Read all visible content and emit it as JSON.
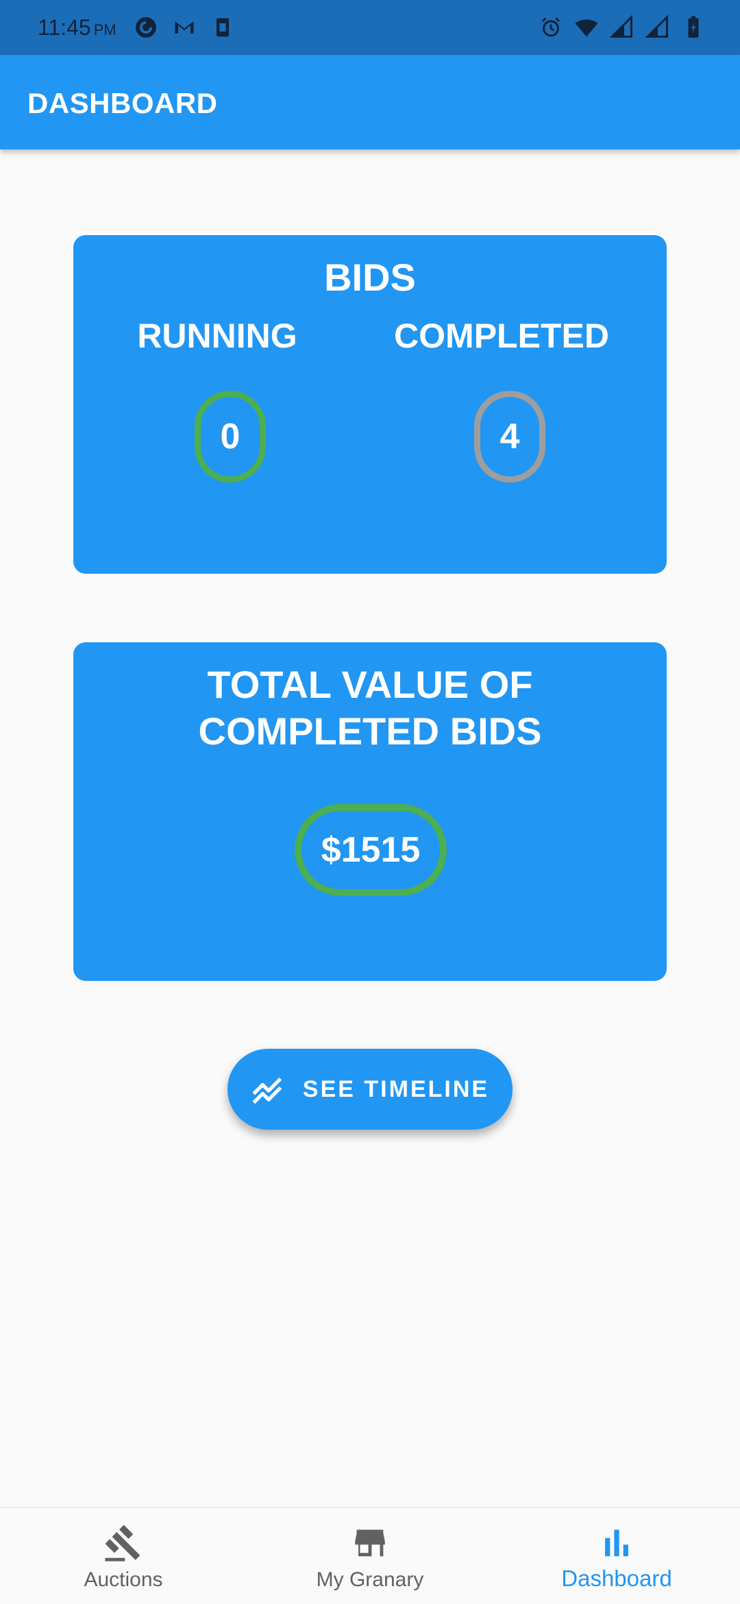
{
  "status_bar": {
    "time": "11:45",
    "ampm": "PM",
    "left_icons": [
      "pocket-casts-icon",
      "gmail-icon",
      "sim-card-icon"
    ],
    "right_icons": [
      "alarm-icon",
      "wifi-icon",
      "signal-icon",
      "signal-icon",
      "battery-icon"
    ]
  },
  "app_bar": {
    "title": "DASHBOARD"
  },
  "bids_card": {
    "title": "BIDS",
    "running_label": "RUNNING",
    "running_count": "0",
    "completed_label": "COMPLETED",
    "completed_count": "4"
  },
  "total_card": {
    "title": "TOTAL VALUE OF COMPLETED BIDS",
    "value": "$1515"
  },
  "timeline_button": {
    "label": "SEE TIMELINE",
    "icon": "trending-icon"
  },
  "bottom_nav": {
    "items": [
      {
        "label": "Auctions",
        "icon": "gavel-icon",
        "active": false
      },
      {
        "label": "My Granary",
        "icon": "store-icon",
        "active": false
      },
      {
        "label": "Dashboard",
        "icon": "bar-chart-icon",
        "active": true
      }
    ]
  },
  "colors": {
    "primary": "#2196f3",
    "status_bar": "#1c6db8",
    "running_ring": "#4caf50",
    "completed_ring": "#9e9e9e",
    "total_ring": "#4caf50",
    "nav_inactive": "#616161",
    "nav_active": "#2196f3"
  }
}
